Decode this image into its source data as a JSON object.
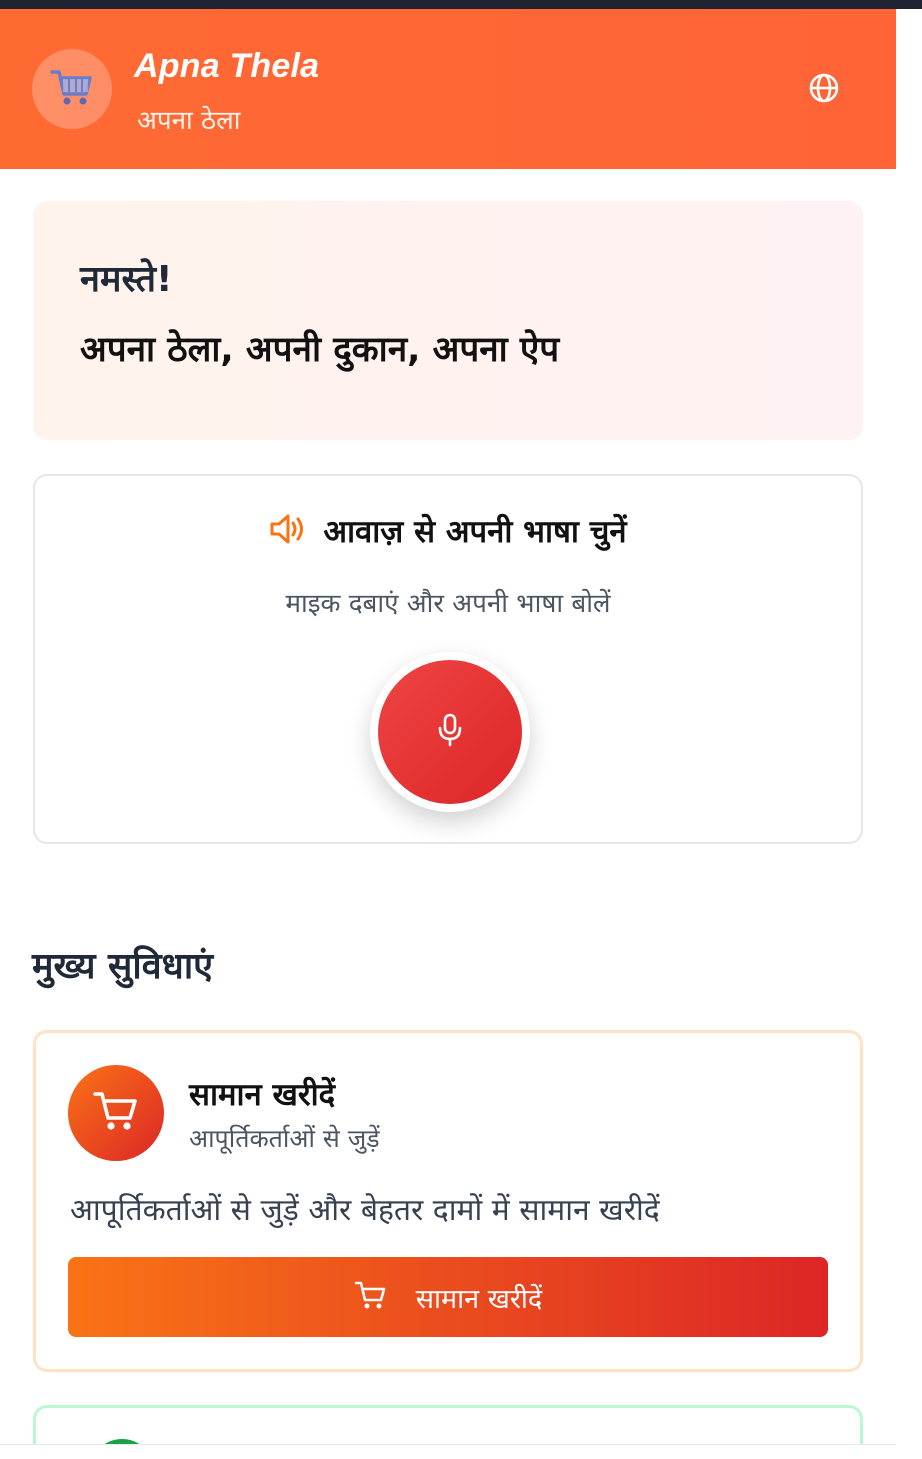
{
  "header": {
    "app_title": "Apna Thela",
    "app_subtitle": "अपना ठेला",
    "logo_icon": "shopping-cart-icon",
    "language_icon": "globe-icon",
    "background_color": "#ff6a33"
  },
  "welcome": {
    "greeting": "नमस्ते!",
    "tagline": "अपना ठेला, अपनी दुकान, अपना ऐप"
  },
  "voice_language": {
    "title": "आवाज़ से अपनी भाषा चुनें",
    "instruction": "माइक दबाएं और अपनी भाषा बोलें",
    "title_icon": "speaker-icon",
    "mic_icon": "microphone-icon",
    "mic_color": "#dc2626"
  },
  "features": {
    "section_title": "मुख्य सुविधाएं",
    "items": [
      {
        "icon": "shopping-cart-icon",
        "title": "सामान खरीदें",
        "subtitle": "आपूर्तिकर्ताओं से जुड़ें",
        "description": "आपूर्तिकर्ताओं से जुड़ें और बेहतर दामों में सामान खरीदें",
        "button_label": "सामान खरीदें",
        "accent": "#f97316"
      }
    ],
    "next_accent": "#16a34a"
  }
}
